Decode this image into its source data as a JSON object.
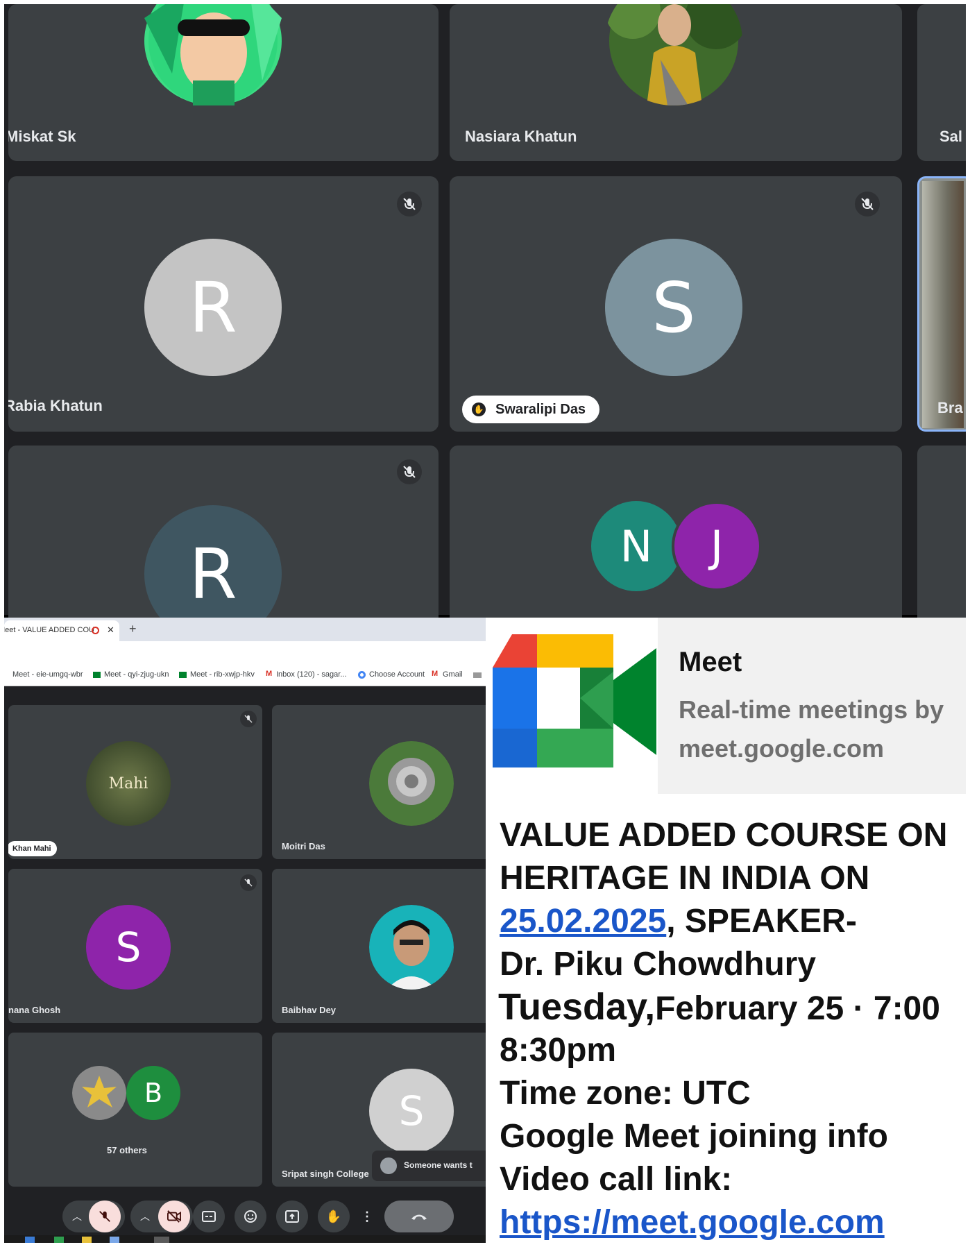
{
  "top_grid": {
    "tiles": [
      {
        "name": "Miskat Sk"
      },
      {
        "name": "Nasiara Khatun"
      },
      {
        "name": "Sal"
      },
      {
        "name": "Rabia Khatun",
        "initial": "R",
        "color": "#c4c4c4"
      },
      {
        "name": "Swaralipi Das",
        "initial": "S",
        "color": "#7c939e"
      },
      {
        "name": "Bra"
      },
      {
        "initial": "R",
        "color": "#3f5661"
      },
      {
        "initials": [
          "N",
          "J"
        ],
        "colors": [
          "#1d8a7a",
          "#8e24aa"
        ]
      }
    ]
  },
  "browser": {
    "tab_title": "Meet - VALUE ADDED COU",
    "new_tab": "+",
    "bookmarks": [
      "Meet - eie-umgq-wbr",
      "Meet - qyi-zjug-ukn",
      "Meet - rib-xwjp-hkv",
      "Inbox (120) - sagar...",
      "Choose Account",
      "Gmail"
    ]
  },
  "bottom_grid": {
    "tiles": [
      {
        "name": "Khan Mahi",
        "avatar_text": "Mahi"
      },
      {
        "name": "Moitri Das"
      },
      {
        "name": "nana Ghosh",
        "initial": "S",
        "color": "#8e24aa"
      },
      {
        "name": "Baibhav Dey"
      },
      {
        "name": "57 others",
        "initial": "B",
        "color": "#1e8e3e"
      },
      {
        "name": "Sripat singh College",
        "initial": "S",
        "color": "#d0d0d0"
      }
    ],
    "toast": "Someone wants t"
  },
  "meet_card": {
    "title": "Meet",
    "subtitle": "Real-time meetings by",
    "domain": "meet.google.com"
  },
  "announcement": {
    "line1": "VALUE ADDED COURSE ON",
    "line2": "HERITAGE IN INDIA ON",
    "date_link": "25.02.2025",
    "speaker_label": ", SPEAKER-",
    "speaker": "Dr. Piku Chowdhury",
    "when_day": "Tuesday,",
    "when_rest": "February 25 · 7:00",
    "end_time": "8:30pm",
    "timezone": "Time zone: UTC",
    "join_info": "Google Meet joining info",
    "link_label": "Video call link:",
    "link": "https://meet.google.com"
  },
  "colors": {
    "tile_bg": "#3c4043",
    "link_blue": "#1a56c9",
    "end_call_red": "#6b6e72"
  }
}
